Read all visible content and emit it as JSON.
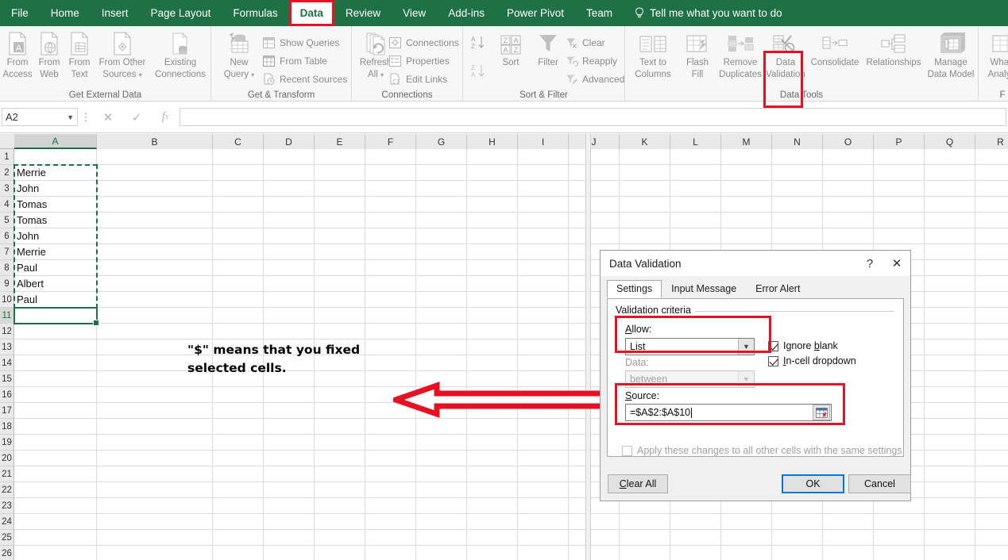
{
  "ribbon": {
    "tabs": [
      {
        "label": "File",
        "active": false
      },
      {
        "label": "Home",
        "active": false
      },
      {
        "label": "Insert",
        "active": false
      },
      {
        "label": "Page Layout",
        "active": false
      },
      {
        "label": "Formulas",
        "active": false
      },
      {
        "label": "Data",
        "active": true
      },
      {
        "label": "Review",
        "active": false
      },
      {
        "label": "View",
        "active": false
      },
      {
        "label": "Add-ins",
        "active": false
      },
      {
        "label": "Power Pivot",
        "active": false
      },
      {
        "label": "Team",
        "active": false
      }
    ],
    "tell_me": "Tell me what you want to do",
    "accent_green": "#1e7145",
    "highlight_red": "#e81123",
    "groups": [
      {
        "name": "Get External Data",
        "buttons": [
          {
            "label_top": "From",
            "label_bottom": "Access",
            "icon": "from-access-icon"
          },
          {
            "label_top": "From",
            "label_bottom": "Web",
            "icon": "from-web-icon"
          },
          {
            "label_top": "From",
            "label_bottom": "Text",
            "icon": "from-text-icon"
          },
          {
            "label_top": "From Other",
            "label_bottom": "Sources",
            "icon": "from-other-sources-icon"
          },
          {
            "label_top": "Existing",
            "label_bottom": "Connections",
            "icon": "existing-connections-icon"
          }
        ]
      },
      {
        "name": "Get & Transform",
        "buttons": [
          {
            "label_top": "New",
            "label_bottom": "Query",
            "icon": "new-query-icon"
          }
        ],
        "small_buttons": [
          {
            "label": "Show Queries",
            "icon": "show-queries-icon"
          },
          {
            "label": "From Table",
            "icon": "from-table-icon"
          },
          {
            "label": "Recent Sources",
            "icon": "recent-sources-icon"
          }
        ]
      },
      {
        "name": "Connections",
        "buttons": [
          {
            "label_top": "Refresh",
            "label_bottom": "All",
            "icon": "refresh-all-icon"
          }
        ],
        "small_buttons": [
          {
            "label": "Connections",
            "icon": "connections-icon"
          },
          {
            "label": "Properties",
            "icon": "properties-icon"
          },
          {
            "label": "Edit Links",
            "icon": "edit-links-icon"
          }
        ]
      },
      {
        "name": "Sort & Filter",
        "buttons": [
          {
            "label_top": "",
            "label_bottom": "Sort",
            "icon": "sort-icon"
          },
          {
            "label_top": "",
            "label_bottom": "Filter",
            "icon": "filter-icon"
          }
        ],
        "small_buttons": [
          {
            "label": "Clear",
            "icon": "clear-filter-icon"
          },
          {
            "label": "Reapply",
            "icon": "reapply-filter-icon"
          },
          {
            "label": "Advanced",
            "icon": "advanced-filter-icon"
          }
        ],
        "sort_az": "A\nZ",
        "sort_za": "Z\nA"
      },
      {
        "name": "Data Tools",
        "buttons": [
          {
            "label_top": "Text to",
            "label_bottom": "Columns",
            "icon": "text-to-columns-icon"
          },
          {
            "label_top": "Flash",
            "label_bottom": "Fill",
            "icon": "flash-fill-icon"
          },
          {
            "label_top": "Remove",
            "label_bottom": "Duplicates",
            "icon": "remove-duplicates-icon"
          },
          {
            "label_top": "Data",
            "label_bottom": "Validation",
            "icon": "data-validation-icon"
          },
          {
            "label_top": "",
            "label_bottom": "Consolidate",
            "icon": "consolidate-icon"
          },
          {
            "label_top": "",
            "label_bottom": "Relationships",
            "icon": "relationships-icon"
          },
          {
            "label_top": "Manage",
            "label_bottom": "Data Model",
            "icon": "manage-data-model-icon"
          }
        ]
      },
      {
        "name": "F",
        "buttons": [
          {
            "label_top": "What-If",
            "label_bottom": "Analysis",
            "icon": "what-if-analysis-icon"
          }
        ]
      }
    ]
  },
  "formula_bar": {
    "name_box_value": "A2",
    "cancel_icon": "cancel-icon",
    "confirm_icon": "confirm-icon",
    "fx_icon": "insert-function-icon",
    "formula_value": ""
  },
  "sheet": {
    "columns": [
      "A",
      "B",
      "C",
      "D",
      "E",
      "F",
      "G",
      "H",
      "I",
      "J",
      "K",
      "L",
      "M",
      "N",
      "O",
      "P",
      "Q",
      "R"
    ],
    "selected_column": "A",
    "rows": [
      1,
      2,
      3,
      4,
      5,
      6,
      7,
      8,
      9,
      10,
      11,
      12,
      13,
      14,
      15,
      16,
      17,
      18,
      19,
      20,
      21,
      22,
      23,
      24,
      25,
      26
    ],
    "selected_row": 11,
    "column_a_values": {
      "2": "Merrie",
      "3": "John",
      "4": "Tomas",
      "5": "Tomas",
      "6": "John",
      "7": "Merrie",
      "8": "Paul",
      "9": "Albert",
      "10": "Paul"
    },
    "copy_marquee_range": "A2:A10",
    "active_cell": "A11"
  },
  "annotation": {
    "line1": "\"$\" means that you fixed",
    "line2": "selected cells.",
    "arrow": "left-arrow-callout"
  },
  "dialog": {
    "title": "Data Validation",
    "help_icon": "help-icon",
    "close_icon": "close-icon",
    "tabs": [
      {
        "label": "Settings",
        "active": true
      },
      {
        "label": "Input Message",
        "active": false
      },
      {
        "label": "Error Alert",
        "active": false
      }
    ],
    "legend": "Validation criteria",
    "allow_label": "Allow:",
    "allow_value": "List",
    "ignore_blank_label": "Ignore blank",
    "ignore_blank_checked": true,
    "in_cell_dropdown_label": "In-cell dropdown",
    "in_cell_dropdown_checked": true,
    "data_label": "Data:",
    "data_value": "between",
    "source_label": "Source:",
    "source_value": "=$A$2:$A$10",
    "range_picker_icon": "collapse-dialog-icon",
    "apply_all_label": "Apply these changes to all other cells with the same settings",
    "apply_all_checked": false,
    "clear_all_label": "Clear All",
    "ok_label": "OK",
    "cancel_label": "Cancel"
  }
}
